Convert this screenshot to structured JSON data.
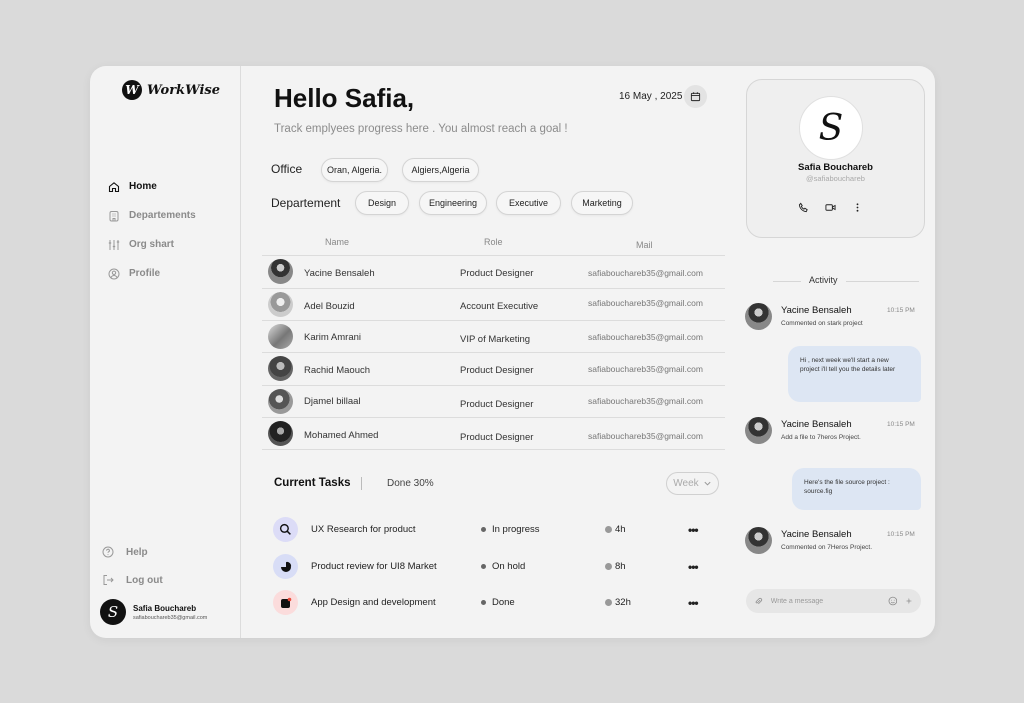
{
  "brand": {
    "logo_letter": "W",
    "name": "WorkWise"
  },
  "sidebar": {
    "items": [
      {
        "label": "Home",
        "icon": "home-icon",
        "active": true
      },
      {
        "label": "Departements",
        "icon": "building-icon",
        "active": false
      },
      {
        "label": "Org shart",
        "icon": "org-chart-icon",
        "active": false
      },
      {
        "label": "Profile",
        "icon": "user-icon",
        "active": false
      }
    ],
    "bottom": [
      {
        "label": "Help",
        "icon": "help-icon"
      },
      {
        "label": "Log out",
        "icon": "logout-icon"
      }
    ],
    "user": {
      "initial": "S",
      "name": "Safia Bouchareb",
      "email": "safiabouchareb35@gmail.com"
    }
  },
  "header": {
    "greeting": "Hello Safia,",
    "subtitle": "Track emplyees progress here . You  almost reach a goal !",
    "date": "16 May , 2025"
  },
  "filters": {
    "office_label": "Office",
    "offices": [
      "Oran, Algeria.",
      "Algiers,Algeria"
    ],
    "department_label": "Departement",
    "departments": [
      "Design",
      "Engineering",
      "Executive",
      "Marketing"
    ]
  },
  "table": {
    "headers": {
      "name": "Name",
      "role": "Role",
      "mail": "Mail"
    },
    "rows": [
      {
        "name": "Yacine Bensaleh",
        "role": "Product Designer",
        "mail": "safiabouchareb35@gmail.com"
      },
      {
        "name": "Adel Bouzid",
        "role": "Account Executive",
        "mail": "safiabouchareb35@gmail.com"
      },
      {
        "name": "Karim Amrani",
        "role": "VIP of Marketing",
        "mail": "safiabouchareb35@gmail.com"
      },
      {
        "name": "Rachid Maouch",
        "role": "Product Designer",
        "mail": "safiabouchareb35@gmail.com"
      },
      {
        "name": "Djamel billaal",
        "role": "Product Designer",
        "mail": "safiabouchareb35@gmail.com"
      },
      {
        "name": "Mohamed Ahmed",
        "role": "Product Designer",
        "mail": "safiabouchareb35@gmail.com"
      }
    ]
  },
  "tasks": {
    "title": "Current Tasks",
    "done": "Done 30%",
    "period": "Week",
    "items": [
      {
        "name": "UX Research for product",
        "status": "In progress",
        "time": "4h",
        "icon": "search-icon",
        "icon_bg": "#dcdcf7"
      },
      {
        "name": "Product review for UI8 Market",
        "status": "On hold",
        "time": "8h",
        "icon": "pie-chart-icon",
        "icon_bg": "#d8ddf6"
      },
      {
        "name": "App Design and development",
        "status": "Done",
        "time": "32h",
        "icon": "app-icon",
        "icon_bg": "#fbdcdc"
      }
    ]
  },
  "profile": {
    "initial": "S",
    "name": "Safia Bouchareb",
    "handle": "@safiabouchareb"
  },
  "activity": {
    "title": "Activity",
    "items": [
      {
        "name": "Yacine Bensaleh",
        "time": "10:15 PM",
        "text": "Commented on stark project"
      },
      {
        "name": "Yacine Bensaleh",
        "time": "10:15 PM",
        "text": "Add a file to 7heros Project."
      },
      {
        "name": "Yacine Bensaleh",
        "time": "10:15 PM",
        "text": "Commented on 7Heros Project."
      }
    ],
    "bubbles": [
      "Hi , next week we'll start a new project i'll tell you the details later",
      "Here's the file source project : source.fig"
    ]
  },
  "message": {
    "placeholder": "Write a message"
  }
}
